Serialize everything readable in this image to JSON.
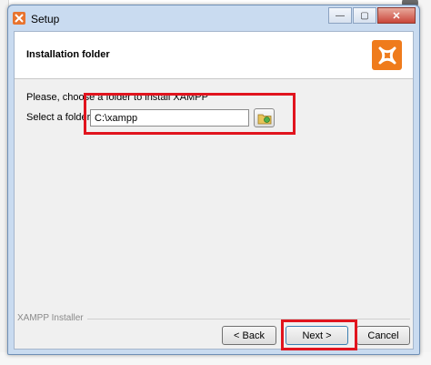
{
  "window": {
    "title": "Setup",
    "minimize_glyph": "—",
    "maximize_glyph": "▢",
    "close_glyph": "✕"
  },
  "header": {
    "title": "Installation folder",
    "logo_icon": "xampp-logo-icon"
  },
  "body": {
    "prompt": "Please, choose a folder to install XAMPP",
    "folder_label": "Select a folder",
    "folder_value": "C:\\xampp",
    "browse_icon": "browse-folder-icon"
  },
  "footer": {
    "installer_label": "XAMPP Installer",
    "back_label": "< Back",
    "next_label": "Next >",
    "cancel_label": "Cancel"
  },
  "colors": {
    "accent": "#ef7b1c",
    "highlight": "#e1141e"
  }
}
